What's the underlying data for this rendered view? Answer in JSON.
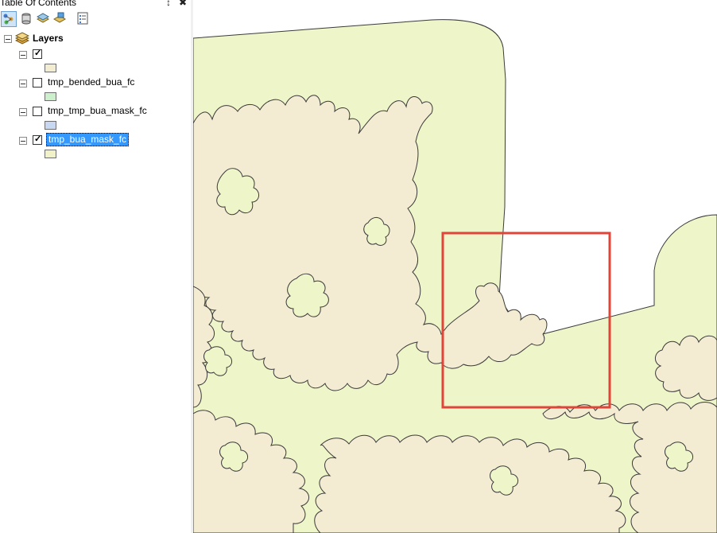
{
  "toc": {
    "title": "Table Of Contents",
    "pin_glyph": "↕",
    "close_glyph": "✖",
    "toolbar": [
      {
        "name": "list-by-drawing-order-icon",
        "selected": true
      },
      {
        "name": "list-by-source-icon",
        "selected": false
      },
      {
        "name": "list-by-visibility-icon",
        "selected": false
      },
      {
        "name": "list-by-selection-icon",
        "selected": false
      },
      {
        "name": "options-icon",
        "selected": false
      }
    ],
    "root_label": "Layers",
    "layers": [
      {
        "label": "",
        "checked": true,
        "swatch": "#f2ecd0"
      },
      {
        "label": "tmp_bended_bua_fc",
        "checked": false,
        "swatch": "#ccf0cc"
      },
      {
        "label": "tmp_tmp_bua_mask_fc",
        "checked": false,
        "swatch": "#c8d8f0"
      },
      {
        "label": "tmp_bua_mask_fc",
        "checked": true,
        "swatch": "#f2f2c8",
        "selected": true
      }
    ]
  },
  "map": {
    "colors": {
      "mask_fill": "#eef5c9",
      "bua_fill": "#f3ecd2",
      "outline": "#3a3a3a",
      "highlight_box": "#e0453a",
      "background": "#ffffff"
    }
  }
}
